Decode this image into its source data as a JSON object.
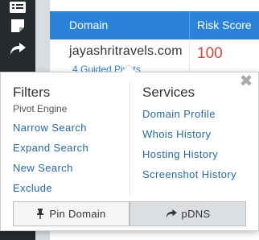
{
  "table": {
    "headers": {
      "domain": "Domain",
      "risk": "Risk Score"
    },
    "row": {
      "domain": "jayashritravels.com",
      "risk": "100",
      "guided_link": "4 Guided Pivots"
    }
  },
  "popover": {
    "filters": {
      "heading": "Filters",
      "subheading": "Pivot Engine",
      "items": [
        "Narrow Search",
        "Expand Search",
        "New Search",
        "Exclude"
      ]
    },
    "services": {
      "heading": "Services",
      "items": [
        "Domain Profile",
        "Whois History",
        "Hosting History",
        "Screenshot History"
      ]
    },
    "close_glyph": "✖",
    "buttons": {
      "pin": "Pin Domain",
      "pdns": "pDNS"
    }
  },
  "colors": {
    "header_bg": "#2b82d9",
    "risk": "#e0453c",
    "link": "#2469a8",
    "sidebar": "#252a2e"
  }
}
